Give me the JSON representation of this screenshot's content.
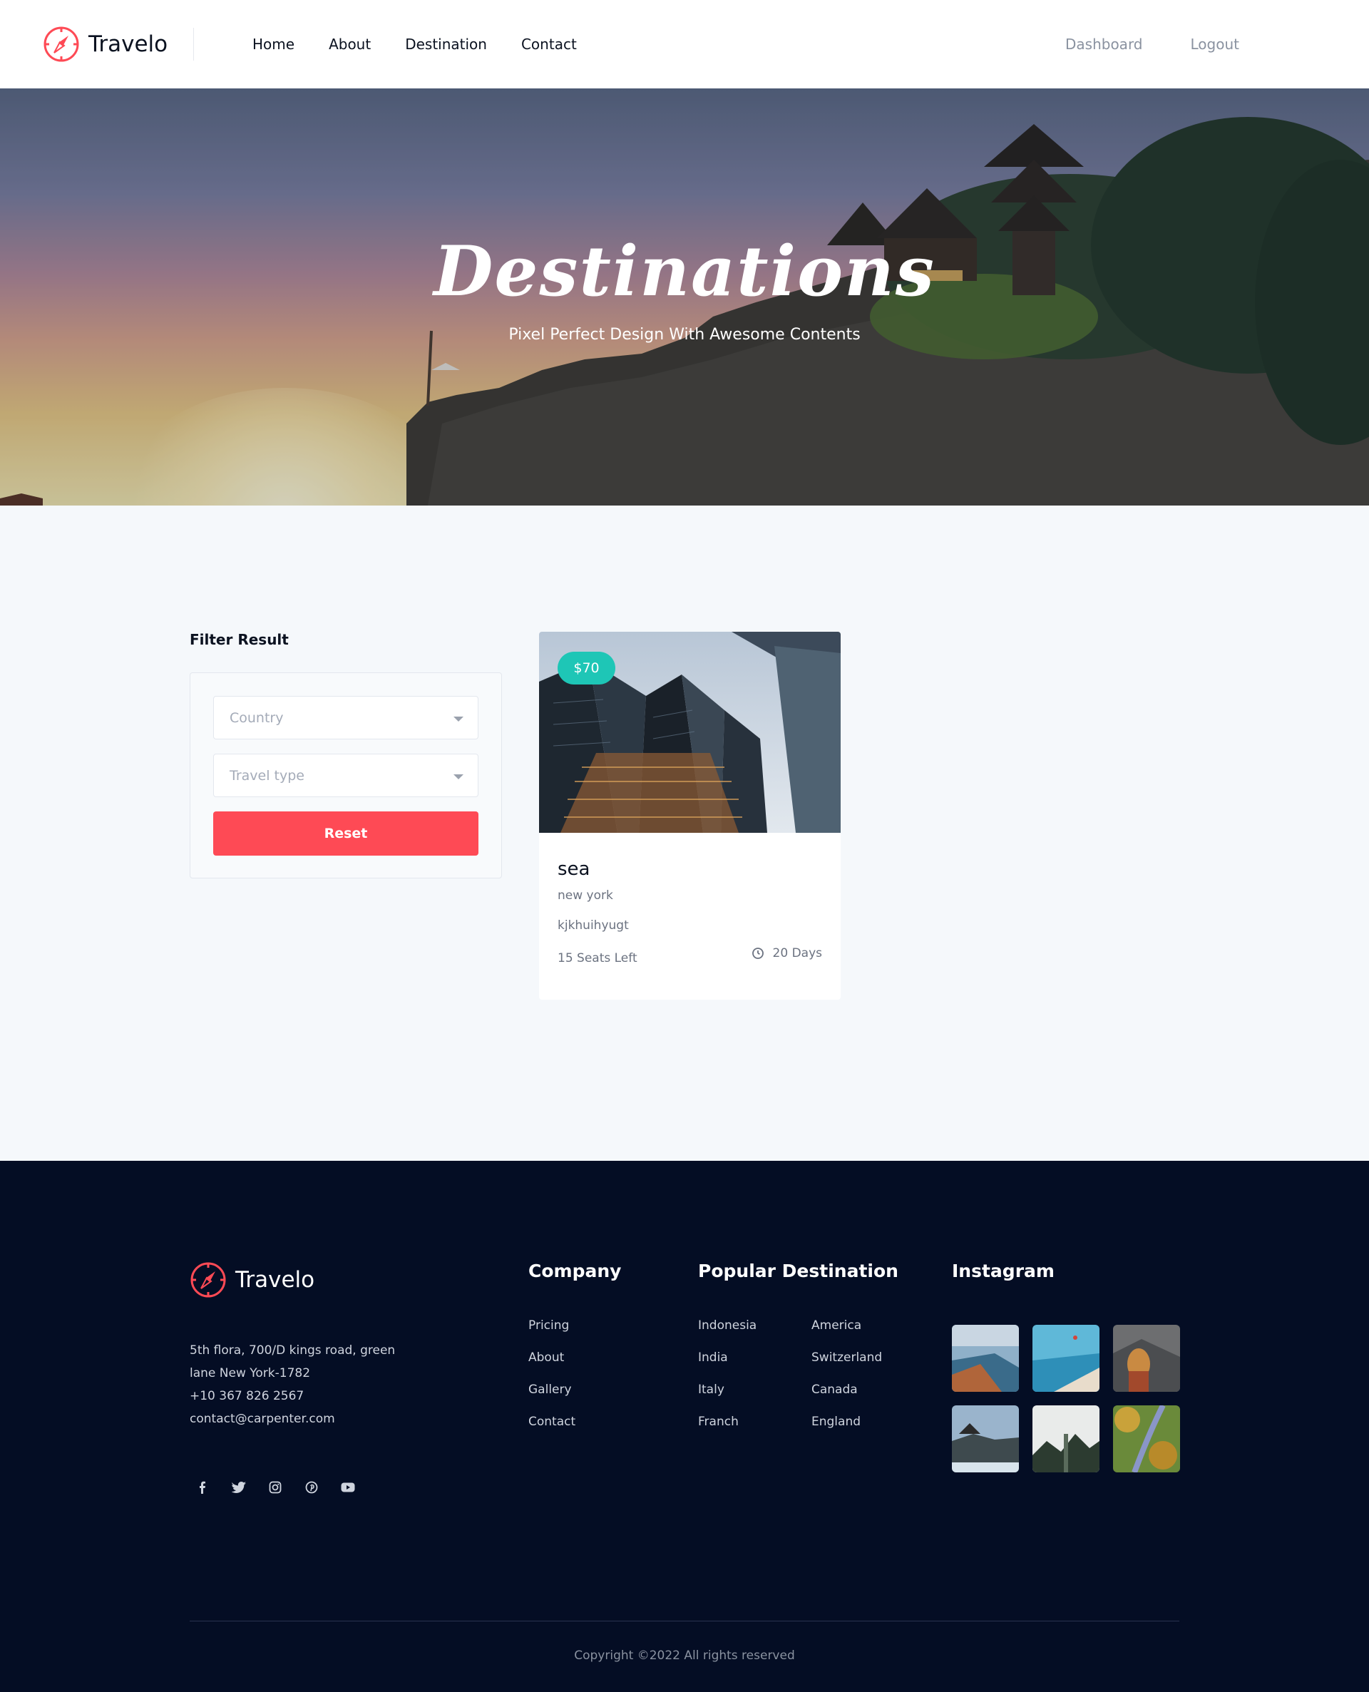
{
  "header": {
    "brand": "Travelo",
    "nav": [
      "Home",
      "About",
      "Destination",
      "Contact"
    ],
    "right_links": [
      "Dashboard",
      "Logout"
    ]
  },
  "hero": {
    "title": "Destinations",
    "subtitle": "Pixel Perfect Design With Awesome Contents"
  },
  "filter": {
    "title": "Filter Result",
    "country_placeholder": "Country",
    "travel_type_placeholder": "Travel type",
    "reset_label": "Reset"
  },
  "card": {
    "price": "$70",
    "title": "sea",
    "location": "new york",
    "description": "kjkhuihyugt",
    "seats": "15 Seats Left",
    "days": "20 Days"
  },
  "footer": {
    "brand": "Travelo",
    "address_line1": "5th flora, 700/D kings road, green",
    "address_line2": "lane New York-1782",
    "phone": "+10 367 826 2567",
    "email": "contact@carpenter.com",
    "social_icons": [
      "facebook-icon",
      "twitter-icon",
      "instagram-icon",
      "pinterest-icon",
      "youtube-icon"
    ],
    "company_title": "Company",
    "company_links": [
      "Pricing",
      "About",
      "Gallery",
      "Contact"
    ],
    "popular_title": "Popular Destination",
    "popular_col1": [
      "Indonesia",
      "India",
      "Italy",
      "Franch"
    ],
    "popular_col2": [
      "America",
      "Switzerland",
      "Canada",
      "England"
    ],
    "instagram_title": "Instagram",
    "copyright": "Copyright ©2022 All rights reserved"
  },
  "colors": {
    "accent": "#fe4a55",
    "price_badge": "#1ec6b6",
    "footer_bg": "#040d24"
  }
}
